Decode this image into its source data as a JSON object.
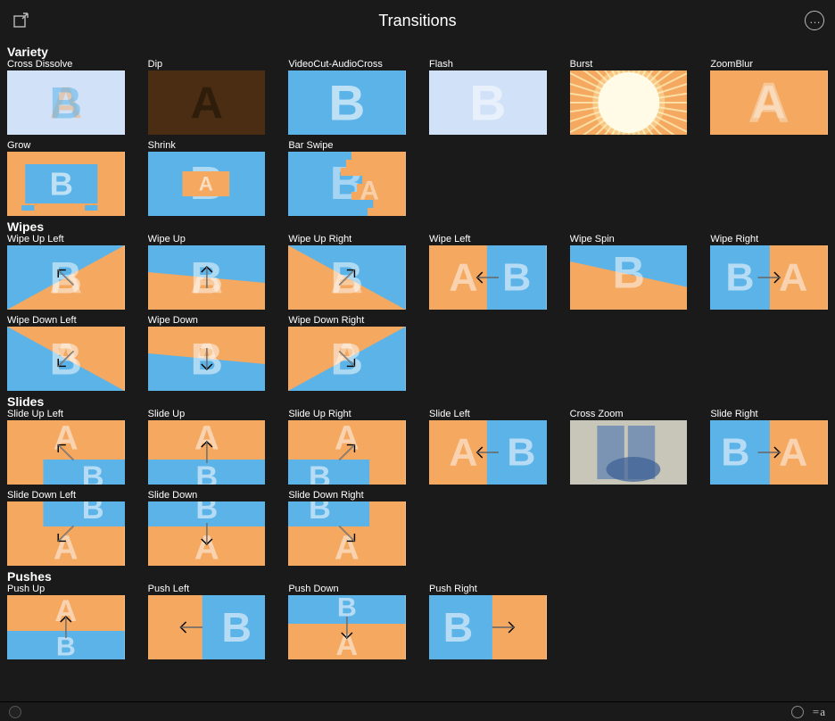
{
  "header": {
    "title": "Transitions"
  },
  "colors": {
    "orange": "#f4a860",
    "blue": "#5cb3e8",
    "paleblue": "#d1e2f8",
    "brown": "#4a2d13"
  },
  "sections": [
    {
      "key": "variety",
      "title": "Variety",
      "items": [
        {
          "label": "Cross Dissolve",
          "kind": "crossdissolve"
        },
        {
          "label": "Dip",
          "kind": "dip"
        },
        {
          "label": "VideoCut-AudioCross",
          "kind": "videocut"
        },
        {
          "label": "Flash",
          "kind": "flash"
        },
        {
          "label": "Burst",
          "kind": "burst"
        },
        {
          "label": "ZoomBlur",
          "kind": "zoomblur"
        },
        {
          "label": "Grow",
          "kind": "grow"
        },
        {
          "label": "Shrink",
          "kind": "shrink"
        },
        {
          "label": "Bar Swipe",
          "kind": "barswipe"
        }
      ]
    },
    {
      "key": "wipes",
      "title": "Wipes",
      "items": [
        {
          "label": "Wipe Up Left",
          "kind": "wipe",
          "dir": "ul"
        },
        {
          "label": "Wipe Up",
          "kind": "wipe",
          "dir": "u"
        },
        {
          "label": "Wipe Up Right",
          "kind": "wipe",
          "dir": "ur"
        },
        {
          "label": "Wipe Left",
          "kind": "wipesplit",
          "dir": "l"
        },
        {
          "label": "Wipe Spin",
          "kind": "wipespin"
        },
        {
          "label": "Wipe Right",
          "kind": "wipesplit",
          "dir": "r"
        },
        {
          "label": "Wipe Down Left",
          "kind": "wipe",
          "dir": "dl"
        },
        {
          "label": "Wipe Down",
          "kind": "wipe",
          "dir": "d"
        },
        {
          "label": "Wipe Down Right",
          "kind": "wipe",
          "dir": "dr"
        }
      ]
    },
    {
      "key": "slides",
      "title": "Slides",
      "items": [
        {
          "label": "Slide Up Left",
          "kind": "slide",
          "dir": "ul"
        },
        {
          "label": "Slide Up",
          "kind": "slide",
          "dir": "u"
        },
        {
          "label": "Slide Up Right",
          "kind": "slide",
          "dir": "ur"
        },
        {
          "label": "Slide Left",
          "kind": "slidesplit",
          "dir": "l"
        },
        {
          "label": "Cross Zoom",
          "kind": "crosszoom"
        },
        {
          "label": "Slide Right",
          "kind": "slidesplit",
          "dir": "r"
        },
        {
          "label": "Slide Down Left",
          "kind": "slide",
          "dir": "dl"
        },
        {
          "label": "Slide Down",
          "kind": "slide",
          "dir": "d"
        },
        {
          "label": "Slide Down Right",
          "kind": "slide",
          "dir": "dr"
        }
      ]
    },
    {
      "key": "pushes",
      "title": "Pushes",
      "items": [
        {
          "label": "Push Up",
          "kind": "push",
          "dir": "u"
        },
        {
          "label": "Push Left",
          "kind": "push",
          "dir": "l"
        },
        {
          "label": "Push Down",
          "kind": "push",
          "dir": "d"
        },
        {
          "label": "Push Right",
          "kind": "push",
          "dir": "r"
        }
      ]
    }
  ],
  "footer": {
    "text": "=a"
  }
}
